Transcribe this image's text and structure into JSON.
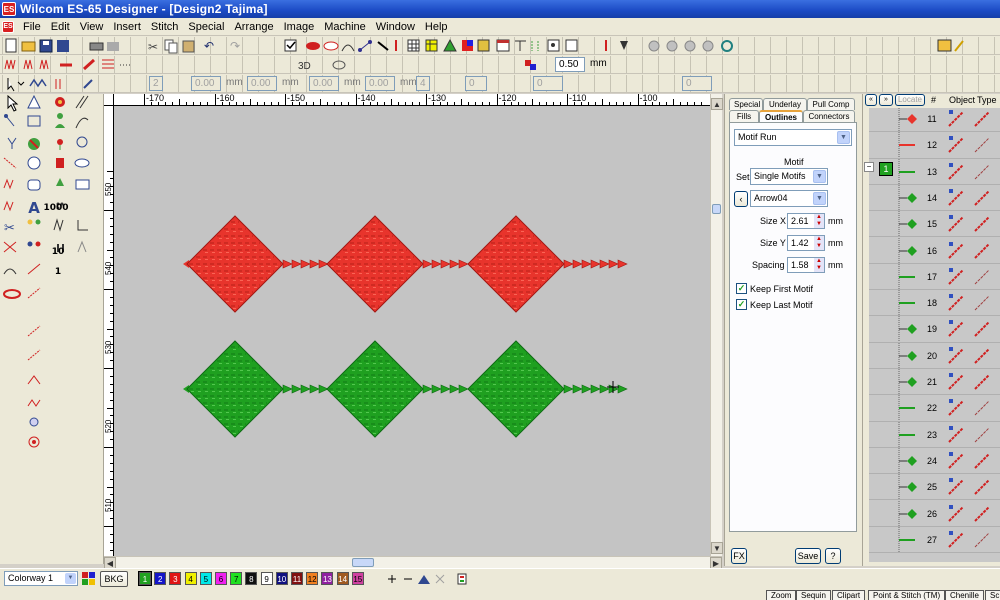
{
  "window": {
    "title": "Wilcom ES-65 Designer - [Design2      Tajima]",
    "logo_text": "ES"
  },
  "menu": [
    "File",
    "Edit",
    "View",
    "Insert",
    "Stitch",
    "Special",
    "Arrange",
    "Image",
    "Machine",
    "Window",
    "Help"
  ],
  "toolbar2": {
    "zoom_value": "0.50",
    "zoom_unit": "mm"
  },
  "toolbar3": {
    "f1": "2",
    "f2": "0.00",
    "u1": "mm",
    "f3": "0.00",
    "u2": "mm",
    "f4": "2",
    "f5": "0.00",
    "u3": "mm",
    "f6": "0.00",
    "u4": "mm",
    "f7": "4",
    "f8": "0",
    "f9": "0",
    "f10": "0"
  },
  "toolbox": {
    "numbers": [
      "1000",
      "10",
      "1",
      "3D"
    ],
    "letter": "A"
  },
  "ruler": {
    "top_labels": [
      "-170",
      "-160",
      "-150",
      "-140",
      "-130",
      "-120",
      "-110",
      "-100"
    ],
    "left_labels": [
      "550",
      "540",
      "530",
      "520",
      "510"
    ]
  },
  "embroidery": {
    "rows": [
      {
        "color": "#e8342c",
        "dark": "#a21712",
        "light": "#ff7060",
        "diamonds": [
          1,
          2,
          3
        ]
      },
      {
        "color": "#1fa020",
        "dark": "#0c6a12",
        "light": "#5fd15a",
        "diamonds": [
          1,
          2,
          3
        ]
      }
    ]
  },
  "props": {
    "tabs_row1": [
      "Special",
      "Underlay",
      "Pull Comp"
    ],
    "tabs_row2": [
      "Fills",
      "Outlines",
      "Connectors"
    ],
    "active_tab": "Outlines",
    "outline_type": "Motif Run",
    "section": "Motif",
    "set_label": "Set",
    "set_value": "Single Motifs",
    "motif_value": "Arrow04",
    "size_x_label": "Size X",
    "size_x": "2.61",
    "size_y_label": "Size Y",
    "size_y": "1.42",
    "spacing_label": "Spacing",
    "spacing": "1.58",
    "unit": "mm",
    "keep_first": "Keep First Motif",
    "keep_last": "Keep Last Motif",
    "save": "Save",
    "help": "?",
    "fx": "FX"
  },
  "sequence": {
    "locate": "Locate",
    "col_num": "#",
    "col_object": "Object",
    "col_type": "Type",
    "group_badge": "1",
    "rows": [
      {
        "n": "11",
        "kind": "diamond",
        "col": "#e8342c"
      },
      {
        "n": "12",
        "kind": "dash",
        "col": "#e8342c"
      },
      {
        "n": "13",
        "kind": "dash",
        "col": "#1fa020"
      },
      {
        "n": "14",
        "kind": "diamond",
        "col": "#1fa020"
      },
      {
        "n": "15",
        "kind": "diamond",
        "col": "#1fa020"
      },
      {
        "n": "16",
        "kind": "diamond",
        "col": "#1fa020"
      },
      {
        "n": "17",
        "kind": "dash",
        "col": "#1fa020"
      },
      {
        "n": "18",
        "kind": "dash",
        "col": "#1fa020"
      },
      {
        "n": "19",
        "kind": "diamond",
        "col": "#1fa020"
      },
      {
        "n": "20",
        "kind": "diamond",
        "col": "#1fa020"
      },
      {
        "n": "21",
        "kind": "diamond",
        "col": "#1fa020"
      },
      {
        "n": "22",
        "kind": "dash",
        "col": "#1fa020"
      },
      {
        "n": "23",
        "kind": "dash",
        "col": "#1fa020"
      },
      {
        "n": "24",
        "kind": "diamond",
        "col": "#1fa020"
      },
      {
        "n": "25",
        "kind": "diamond",
        "col": "#1fa020"
      },
      {
        "n": "26",
        "kind": "diamond",
        "col": "#1fa020"
      },
      {
        "n": "27",
        "kind": "dash",
        "col": "#1fa020"
      }
    ]
  },
  "bottom": {
    "colorway": "Colorway 1",
    "bkg": "BKG",
    "chips": [
      {
        "n": "1",
        "c": "#21a121",
        "fg": "#fff"
      },
      {
        "n": "2",
        "c": "#1414c8",
        "fg": "#fff"
      },
      {
        "n": "3",
        "c": "#e01414",
        "fg": "#fff"
      },
      {
        "n": "4",
        "c": "#f0f000",
        "fg": "#000"
      },
      {
        "n": "5",
        "c": "#00e8e8",
        "fg": "#000"
      },
      {
        "n": "6",
        "c": "#f020f0",
        "fg": "#000"
      },
      {
        "n": "7",
        "c": "#20e020",
        "fg": "#000"
      },
      {
        "n": "8",
        "c": "#101010",
        "fg": "#fff"
      },
      {
        "n": "9",
        "c": "#ffffff",
        "fg": "#000"
      },
      {
        "n": "10",
        "c": "#101080",
        "fg": "#fff"
      },
      {
        "n": "11",
        "c": "#801010",
        "fg": "#fff"
      },
      {
        "n": "12",
        "c": "#f08020",
        "fg": "#000"
      },
      {
        "n": "13",
        "c": "#9020a0",
        "fg": "#fff"
      },
      {
        "n": "14",
        "c": "#a05a20",
        "fg": "#fff"
      },
      {
        "n": "15",
        "c": "#d040a0",
        "fg": "#000"
      }
    ],
    "status_tabs": [
      "Zoom",
      "Sequin",
      "Clipart",
      "Point & Stitch (TM)",
      "Chenille",
      "Sc"
    ]
  }
}
